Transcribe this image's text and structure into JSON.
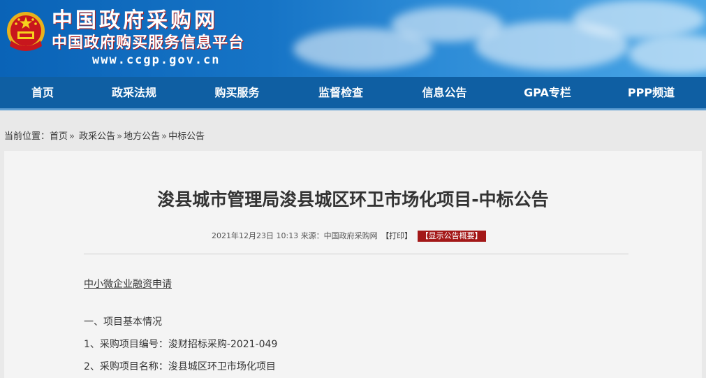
{
  "header": {
    "site_name": "中国政府采购网",
    "site_subtitle": "中国政府购买服务信息平台",
    "site_url": "www.ccgp.gov.cn",
    "colors": {
      "banner": "#0a63b7",
      "nav": "#0f5fa3",
      "badge": "#a31818"
    }
  },
  "nav": {
    "items": [
      {
        "label": "首页"
      },
      {
        "label": "政采法规"
      },
      {
        "label": "购买服务"
      },
      {
        "label": "监督检查"
      },
      {
        "label": "信息公告"
      },
      {
        "label": "GPA专栏"
      },
      {
        "label": "PPP频道"
      }
    ]
  },
  "breadcrumb": {
    "prefix": "当前位置：",
    "items": [
      "首页",
      "政采公告",
      "地方公告",
      "中标公告"
    ],
    "separator": "»"
  },
  "article": {
    "title": "浚县城市管理局浚县城区环卫市场化项目-中标公告",
    "date": "2021年12月23日 10:13",
    "source": "来源：中国政府采购网",
    "print_label": "【打印】",
    "summary_label": "【显示公告概要】",
    "finance_link": "中小微企业融资申请",
    "paragraphs": [
      "一、项目基本情况",
      "1、采购项目编号：浚财招标采购-2021-049",
      "2、采购项目名称：浚县城区环卫市场化项目"
    ]
  }
}
